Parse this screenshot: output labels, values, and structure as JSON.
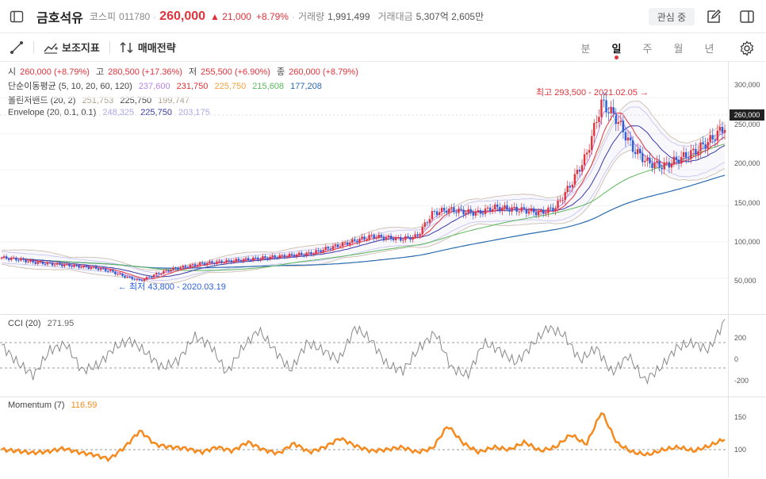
{
  "header": {
    "stock_name": "금호석유",
    "market": "코스피",
    "code": "011780",
    "price": "260,000",
    "change": "21,000",
    "change_pct": "+8.79%",
    "volume_label": "거래량",
    "volume": "1,991,499",
    "amount_label": "거래대금",
    "amount": "5,307억 2,605만",
    "watch_label": "관심 중"
  },
  "toolbar": {
    "indicators_label": "보조지표",
    "strategy_label": "매매전략",
    "periods": [
      "분",
      "일",
      "주",
      "월",
      "년"
    ],
    "active_period": "일"
  },
  "legend": {
    "ohlc": {
      "open_label": "시",
      "open": "260,000 (+8.79%)",
      "high_label": "고",
      "high": "280,500 (+17.36%)",
      "low_label": "저",
      "low": "255,500 (+6.90%)",
      "close_label": "종",
      "close": "260,000 (+8.79%)"
    },
    "sma": {
      "label": "단순이동평균 (5, 10, 20, 60, 120)",
      "values": [
        "237,600",
        "231,750",
        "225,750",
        "215,608",
        "177,208"
      ],
      "colors": [
        "#b784e8",
        "#e2323b",
        "#f0a23b",
        "#5cb85c",
        "#2b6cb0"
      ]
    },
    "bollinger": {
      "label": "볼린저밴드 (20, 2)",
      "values": [
        "251,753",
        "225,750",
        "199,747"
      ],
      "colors": [
        "#b0a090",
        "#444444",
        "#b0a090"
      ]
    },
    "envelope": {
      "label": "Envelope (20, 0.1, 0.1)",
      "values": [
        "248,325",
        "225,750",
        "203,175"
      ],
      "colors": [
        "#a8a8e6",
        "#3a3aa8",
        "#a8a8e6"
      ]
    }
  },
  "price_axis": {
    "ticks": [
      "300,000",
      "250,000",
      "200,000",
      "150,000",
      "100,000",
      "50,000"
    ],
    "current_tag": "260,000"
  },
  "annotations": {
    "high": "최고 293,500 - 2021.02.05 →",
    "low": "← 최저 43,800 - 2020.03.19"
  },
  "cci": {
    "label": "CCI (20)",
    "value": "271.95",
    "ticks": [
      "200",
      "0",
      "-200"
    ]
  },
  "momentum": {
    "label": "Momentum (7)",
    "value": "116.59",
    "ticks": [
      "150",
      "100"
    ]
  },
  "colors": {
    "up": "#e2323b",
    "down": "#2b5fd9",
    "momentum": "#f58a1f",
    "cci": "#888888"
  },
  "chart_data": [
    {
      "type": "line",
      "title": "",
      "xlabel": "",
      "ylabel": "",
      "ylim": [
        0,
        330000
      ],
      "series": [
        {
          "values": [
            78000,
            76000,
            72000,
            70000,
            68000,
            66000,
            64000,
            60000,
            52000,
            46000,
            55000,
            62000,
            66000,
            70000,
            72000,
            74000,
            76000,
            78000,
            80000,
            82000,
            84000,
            90000,
            96000,
            102000,
            108000,
            106000,
            104000,
            108000,
            140000,
            145000,
            142000,
            140000,
            148000,
            146000,
            144000,
            140000,
            148000,
            180000,
            220000,
            293500,
            270000,
            230000,
            210000,
            205000,
            215000,
            225000,
            240000,
            260000
          ]
        }
      ]
    },
    {
      "type": "line",
      "title": "",
      "xlabel": "",
      "ylabel": "",
      "ylim": [
        -300,
        300
      ],
      "series": [
        {
          "name": "CCI (20)",
          "values": [
            80,
            -60,
            -160,
            40,
            90,
            -120,
            -80,
            60,
            120,
            20,
            -100,
            -40,
            150,
            80,
            -140,
            60,
            200,
            40,
            -120,
            100,
            40,
            -40,
            220,
            120,
            -80,
            -120,
            60,
            180,
            -100,
            -160,
            100,
            40,
            -60,
            80,
            220,
            160,
            -40,
            60,
            -140,
            0,
            -200,
            -100,
            60,
            100,
            40,
            272
          ]
        }
      ]
    },
    {
      "type": "line",
      "title": "",
      "xlabel": "",
      "ylabel": "",
      "ylim": [
        70,
        170
      ],
      "series": [
        {
          "name": "Momentum (7)",
          "values": [
            100,
            98,
            95,
            97,
            102,
            96,
            92,
            85,
            104,
            130,
            108,
            104,
            102,
            96,
            104,
            98,
            112,
            100,
            94,
            110,
            96,
            104,
            118,
            106,
            98,
            100,
            104,
            96,
            102,
            138,
            110,
            96,
            104,
            100,
            112,
            98,
            104,
            124,
            108,
            160,
            110,
            96,
            92,
            100,
            104,
            98,
            106,
            117
          ]
        }
      ]
    }
  ]
}
